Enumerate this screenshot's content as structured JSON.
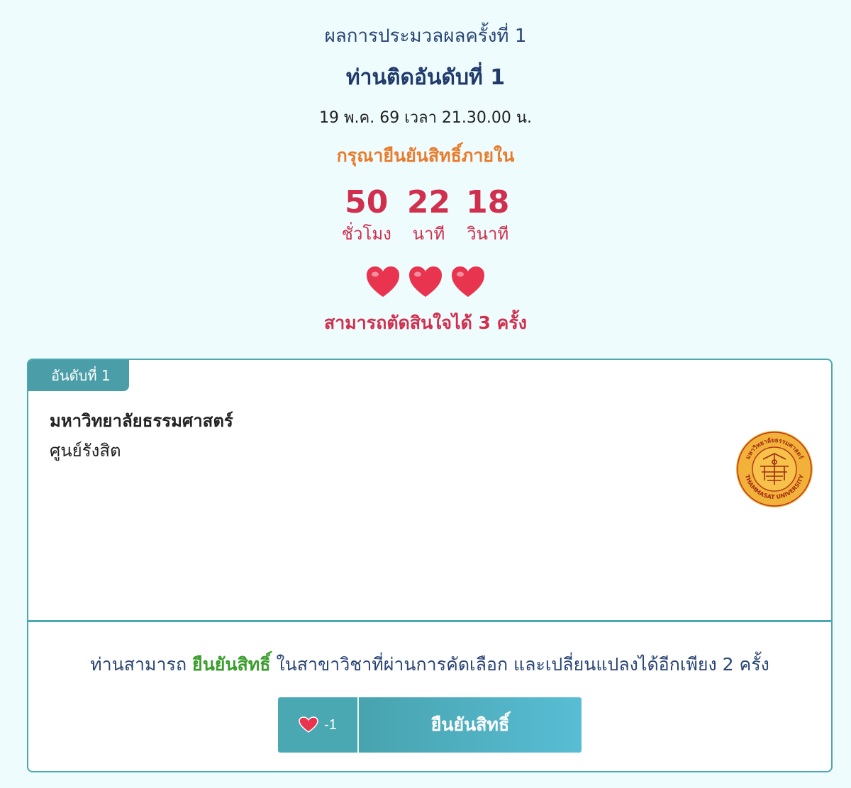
{
  "header": {
    "round_title": "ผลการประมวลผลครั้งที่ 1",
    "rank_title": "ท่านติดอันดับที่ 1",
    "datetime": "19 พ.ค. 69 เวลา 21.30.00 น.",
    "confirm_within": "กรุณายืนยันสิทธิ์ภายใน"
  },
  "countdown": [
    {
      "value": "50",
      "unit": "ชั่วโมง"
    },
    {
      "value": "22",
      "unit": "นาที"
    },
    {
      "value": "18",
      "unit": "วินาที"
    }
  ],
  "hearts": {
    "count": 3,
    "icon": "heart-icon",
    "color": "#e8344f"
  },
  "decisions_text": "สามารถตัดสินใจได้ 3 ครั้ง",
  "card": {
    "rank_tab": "อันดับที่ 1",
    "university": "มหาวิทยาลัยธรรมศาสตร์",
    "campus": "ศูนย์รังสิต",
    "seal_text_top": "มหาวิทยาลัยธรรมศาสตร์",
    "seal_text_bottom": "THAMMASAT UNIVERSITY"
  },
  "info": {
    "prefix": "ท่านสามารถ ",
    "highlight": "ยืนยันสิทธิ์",
    "suffix": " ในสาขาวิชาที่ผ่านการคัดเลือก และเปลี่ยนแปลงได้อีกเพียง 2 ครั้ง"
  },
  "action": {
    "cost_label": "-1",
    "confirm_label": "ยืนยันสิทธิ์"
  },
  "colors": {
    "accent": "#4ba7b1",
    "countdown": "#d0304e",
    "warning": "#e97b2c",
    "highlight": "#3c9d2f",
    "navy": "#1f3a6b"
  }
}
